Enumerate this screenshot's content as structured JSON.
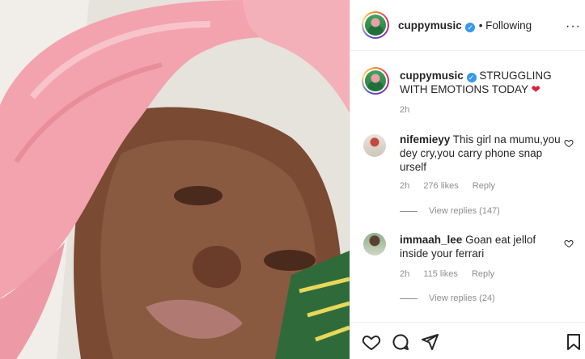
{
  "post": {
    "username": "cuppymusic",
    "follow_status": "• Following",
    "caption": "STRUGGLING WITH EMOTIONS TODAY",
    "caption_emoji": "❤",
    "time": "2h"
  },
  "comments": [
    {
      "username": "nifemieyy",
      "text": "This girl na mumu,you dey cry,you carry phone snap urself",
      "time": "2h",
      "likes": "276 likes",
      "reply": "Reply",
      "view_replies": "View replies (147)"
    },
    {
      "username": "immaah_lee",
      "text": "Goan eat jellof inside your ferrari",
      "time": "2h",
      "likes": "115 likes",
      "reply": "Reply",
      "view_replies": "View replies (24)"
    }
  ],
  "icons": {
    "like": "heart-icon",
    "comment": "comment-icon",
    "share": "paper-plane-icon",
    "save": "bookmark-icon",
    "verified": "verified-badge-icon"
  },
  "colors": {
    "text": "#262626",
    "muted": "#8e8e8e",
    "verified": "#3897f0",
    "hair": "#f2a3ae",
    "broken_heart": "#d1213b"
  }
}
